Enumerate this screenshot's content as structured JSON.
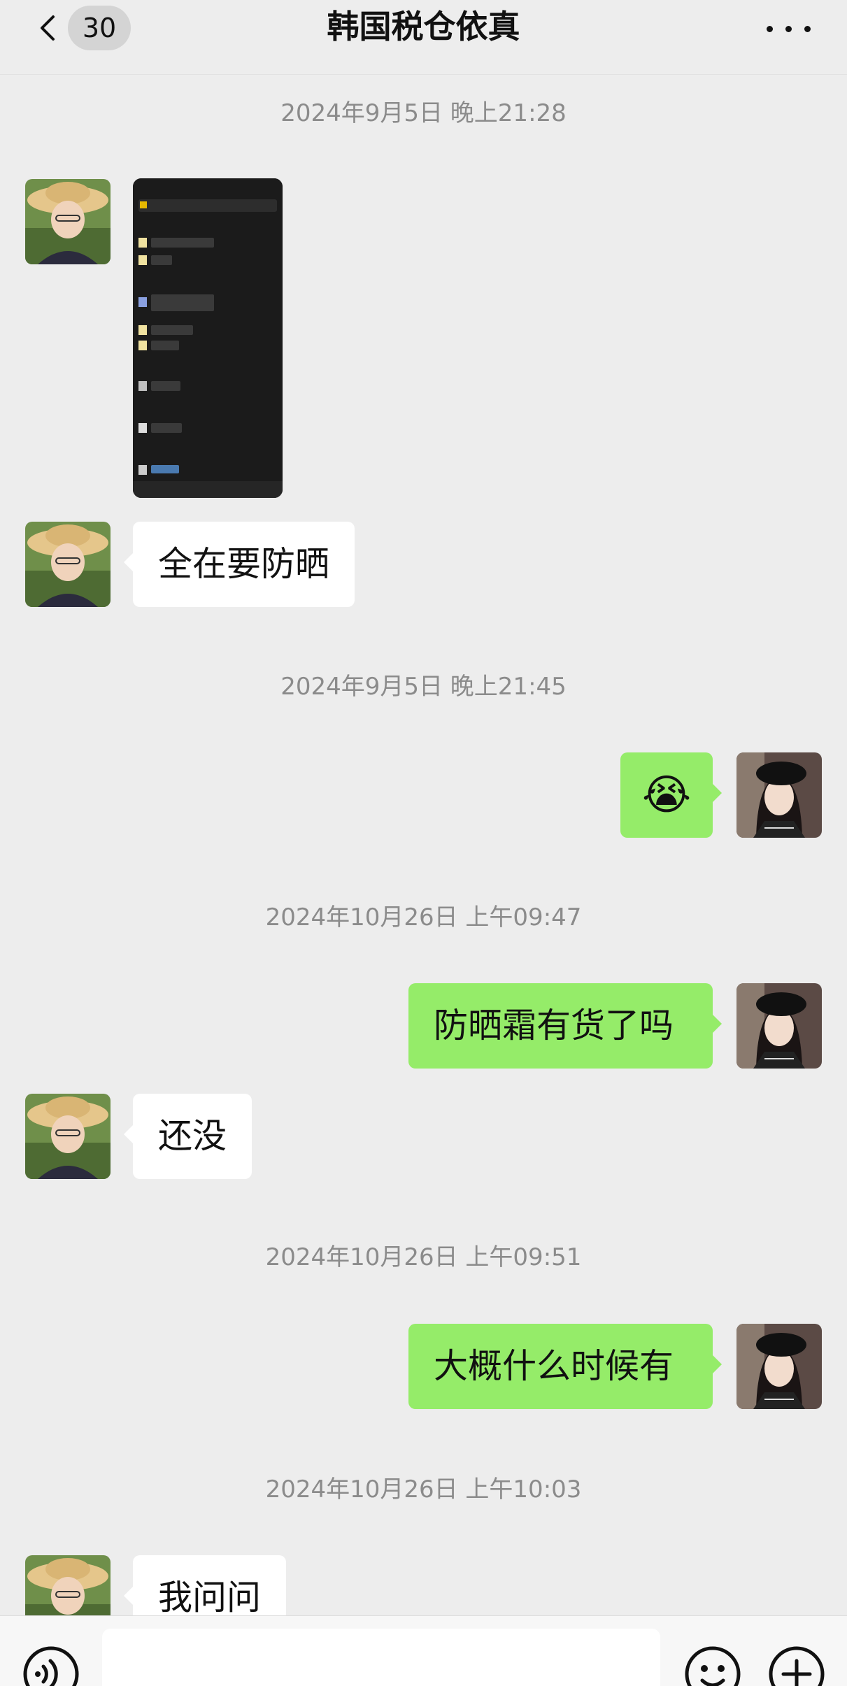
{
  "header": {
    "title": "韩国税仓依真",
    "unread_count": "30",
    "back_icon": "chevron-left-icon",
    "more_icon": "more-horizontal-icon"
  },
  "messages": [
    {
      "type": "timestamp",
      "text": "2024年9月5日 晚上21:28"
    },
    {
      "type": "image",
      "sender": "contact",
      "content": "chat-screenshot-thumbnail"
    },
    {
      "type": "text",
      "sender": "contact",
      "text": "全在要防晒"
    },
    {
      "type": "timestamp",
      "text": "2024年9月5日 晚上21:45"
    },
    {
      "type": "emoji",
      "sender": "me",
      "emoji": "😭"
    },
    {
      "type": "timestamp",
      "text": "2024年10月26日 上午09:47"
    },
    {
      "type": "text",
      "sender": "me",
      "text": "防晒霜有货了吗"
    },
    {
      "type": "text",
      "sender": "contact",
      "text": "还没"
    },
    {
      "type": "timestamp",
      "text": "2024年10月26日 上午09:51"
    },
    {
      "type": "text",
      "sender": "me",
      "text": "大概什么时候有"
    },
    {
      "type": "timestamp",
      "text": "2024年10月26日 上午10:03"
    },
    {
      "type": "text",
      "sender": "contact",
      "text": "我问问"
    }
  ],
  "input_bar": {
    "voice_icon": "voice-icon",
    "emoji_icon": "emoji-face-icon",
    "add_icon": "plus-circle-icon",
    "input_value": ""
  },
  "colors": {
    "background": "#ededed",
    "outgoing_bubble": "#95ec69",
    "incoming_bubble": "#ffffff",
    "timestamp_text": "#8b8b8b"
  }
}
